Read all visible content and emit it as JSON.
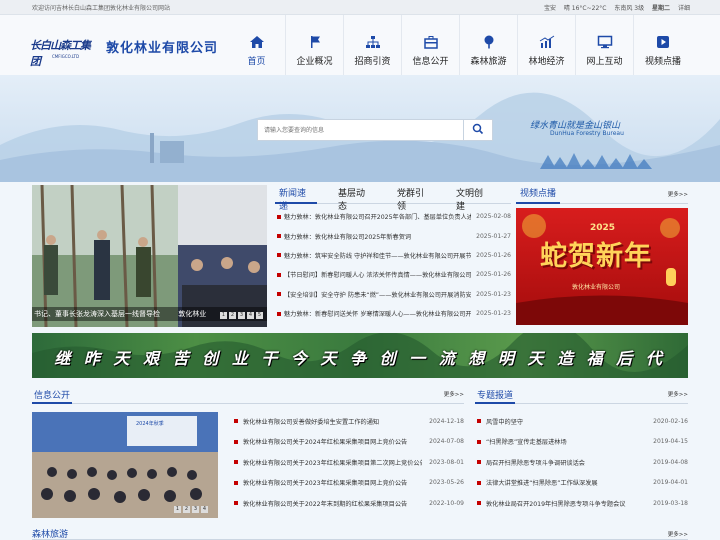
{
  "topbar": {
    "welcome": "欢迎访问吉林长白山森工集团敦化林业有限公司网站",
    "city": "宝安",
    "weather": "晴 16°C~22°C",
    "wind": "东南风 3级",
    "weekday": "星期二",
    "detail": "详细"
  },
  "header": {
    "logo_text": "长白山森工集团",
    "logo_sub": "CMFIGCO.LTD",
    "company": "敦化林业有限公司"
  },
  "nav": [
    {
      "label": "首页",
      "icon": "home-icon"
    },
    {
      "label": "企业概况",
      "icon": "flag-icon"
    },
    {
      "label": "招商引资",
      "icon": "org-chart-icon"
    },
    {
      "label": "信息公开",
      "icon": "briefcase-icon"
    },
    {
      "label": "森林旅游",
      "icon": "tree-icon"
    },
    {
      "label": "林地经济",
      "icon": "chart-icon"
    },
    {
      "label": "网上互动",
      "icon": "monitor-icon"
    },
    {
      "label": "视频点播",
      "icon": "play-icon"
    }
  ],
  "search": {
    "placeholder": "请输入您要查询的信息"
  },
  "slogan": {
    "cn": "绿水青山就是金山银山",
    "en": "DunHua Forestry Bureau"
  },
  "featured": {
    "caption": "书记、董事长张龙涛深入基层一线督导检",
    "caption2": "敦化林业",
    "dots": [
      "1",
      "2",
      "3",
      "4",
      "5"
    ]
  },
  "news_tabs": [
    "新闻速递",
    "基层动态",
    "党群引领",
    "文明创建"
  ],
  "news": [
    {
      "title": "魅力敦林：敦化林业有限公司召开2025年各部门、基层单位负责人述职考评会议",
      "date": "2025-02-08"
    },
    {
      "title": "魅力敦林：敦化林业有限公司2025年新春贺词",
      "date": "2025-01-27"
    },
    {
      "title": "魅力敦林：筑牢安全防线 守护祥和佳节——敦化林业有限公司开展节前安全检查",
      "date": "2025-01-26"
    },
    {
      "title": "【节日慰问】新春慰问暖人心 浓浓关怀传真情——敦化林业有限公司开展春节走访慰问",
      "date": "2025-01-26"
    },
    {
      "title": "【安全培训】安全守护 防患未“燃”——敦化林业有限公司开展消防安全培训",
      "date": "2025-01-23"
    },
    {
      "title": "魅力敦林：新春慰问送关怀 岁寒情深暖人心——敦化林业有限公司开展春节慰问",
      "date": "2025-01-23"
    }
  ],
  "video": {
    "tab": "视频点播",
    "more": "更多>>",
    "poster_title": "蛇贺新年",
    "poster_year": "2025",
    "poster_sub": "敦化林业有限公司"
  },
  "strip": {
    "text": "继 昨 天 艰 苦 创 业   干 今 天 争 创 一 流   想 明 天 造 福 后 代"
  },
  "info": {
    "title": "信息公开",
    "more": "更多>>",
    "photo_badge": "2024年秋季"
  },
  "info_list": [
    {
      "title": "敦化林业有限公司妥善做好委培生安置工作的通知",
      "date": "2024-12-18"
    },
    {
      "title": "敦化林业有限公司关于2024年红松果采集项目网上竞价公告",
      "date": "2024-07-08"
    },
    {
      "title": "敦化林业有限公司关于2023年红松果采集项目第二次网上竞价公告",
      "date": "2023-08-01"
    },
    {
      "title": "敦化林业有限公司关于2023年红松果采集项目网上竞价公告",
      "date": "2023-05-26"
    },
    {
      "title": "敦化林业有限公司关于2022年末到期的红松果采集项目公告",
      "date": "2022-10-09"
    }
  ],
  "special": {
    "title": "专题报道",
    "more": "更多>>"
  },
  "special_list": [
    {
      "title": "风雪中的坚守",
      "date": "2020-02-16"
    },
    {
      "title": "“扫黑除恶”宣传走基层进林场",
      "date": "2019-04-15"
    },
    {
      "title": "局召开扫黑除恶专项斗争调研谈话会",
      "date": "2019-04-08"
    },
    {
      "title": "法律大讲堂推进“扫黑除恶”工作纵深发展",
      "date": "2019-04-01"
    },
    {
      "title": "敦化林业局召开2019年扫黑除恶专项斗争专题会议",
      "date": "2019-03-18"
    }
  ],
  "forest": {
    "title": "森林旅游",
    "more": "更多>>"
  },
  "colors": {
    "accent": "#1e4aa8",
    "bullet": "#c40000"
  }
}
